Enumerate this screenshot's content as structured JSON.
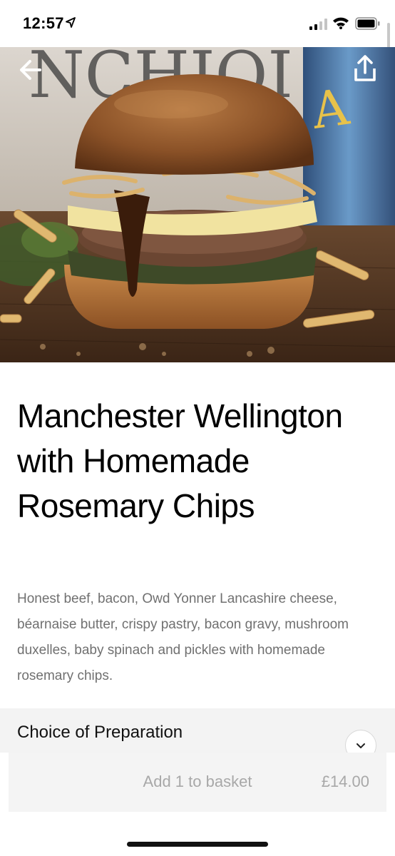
{
  "status_bar": {
    "time": "12:57"
  },
  "item": {
    "title": "Manchester Wellington with Homemade Rosemary Chips",
    "description": "Honest beef, bacon, Owd Yonner Lancashire cheese, béarnaise butter, crispy pastry, bacon gravy, mushroom duxelles, baby spinach and pickles with homemade rosemary chips."
  },
  "choice_section": {
    "title": "Choice of Preparation"
  },
  "basket": {
    "label": "Add 1 to basket",
    "price": "£14.00"
  },
  "icons": {
    "back": "arrow-left-icon",
    "share": "share-upload-icon",
    "expand": "chevron-down-icon"
  }
}
